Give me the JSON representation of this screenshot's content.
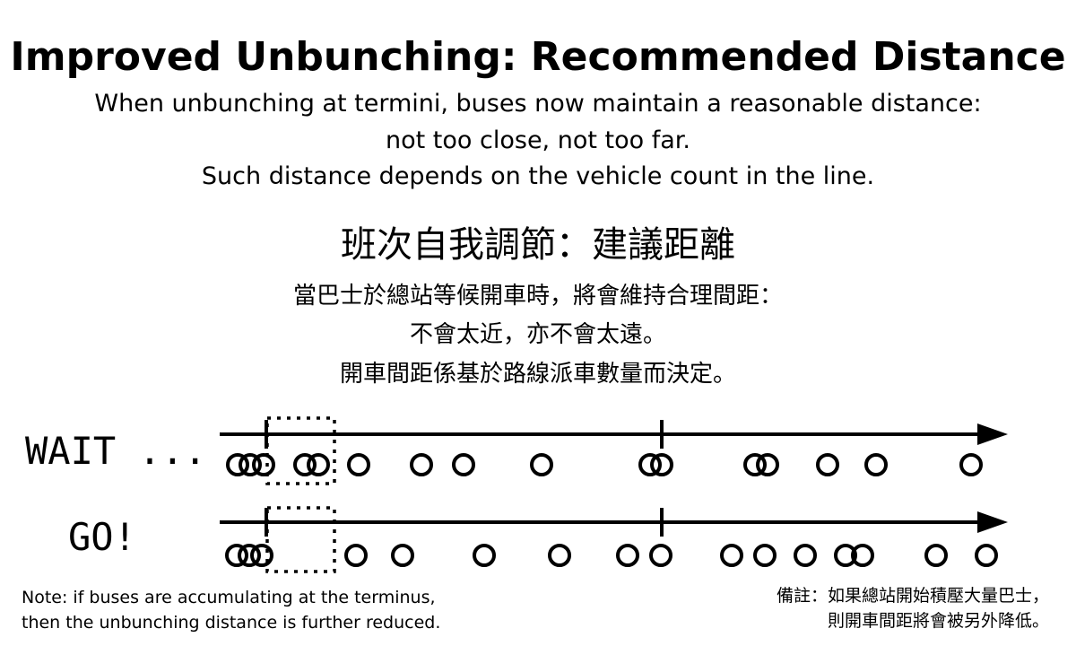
{
  "header": {
    "title": "Improved Unbunching: Recommended Distance",
    "subtitle_lines": [
      "When unbunching at termini, buses now maintain a reasonable distance:",
      "not too close, not too far.",
      "Such distance depends on the vehicle count in the line."
    ]
  },
  "header_zh": {
    "title": "班次自我調節：建議距離",
    "lines": [
      "當巴士於總站等候開車時，將會維持合理間距：",
      "不會太近，亦不會太遠。",
      "開車間距係基於路線派車數量而決定。"
    ]
  },
  "diagram": {
    "rows": [
      {
        "label": "WAIT ...",
        "buses": 17
      },
      {
        "label": "GO!",
        "buses": 17
      }
    ]
  },
  "notes": {
    "en": [
      "Note: if buses are accumulating at the terminus,",
      "then the unbunching distance is further reduced."
    ],
    "zh": [
      "備註：如果總站開始積壓大量巴士，",
      "則開車間距將會被另外降低。"
    ]
  },
  "colors": {
    "ink": "#000000",
    "background": "#ffffff"
  }
}
